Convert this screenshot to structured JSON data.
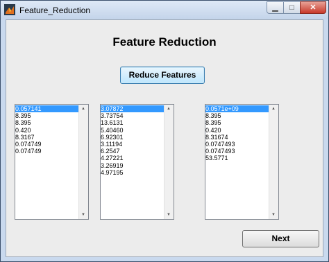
{
  "window": {
    "title": "Feature_Reduction"
  },
  "heading": "Feature Reduction",
  "buttons": {
    "reduce_label": "Reduce Features",
    "next_label": "Next"
  },
  "lists": {
    "list1": [
      "0.057141",
      "8.395",
      "8.395",
      "0.420",
      "8.3167",
      "0.074749",
      "0.074749"
    ],
    "list2": [
      "3.07872",
      "3.73754",
      "13.6131",
      "5.40460",
      "6.92301",
      "3.11194",
      "6.2547",
      "4.27221",
      "3.26919",
      "4.97195"
    ],
    "list3": [
      "0.0571e+09",
      "8.395",
      "8.395",
      "0.420",
      "8.31674",
      "0.0747493",
      "0.0747493",
      "53.5771"
    ]
  },
  "colors": {
    "selection": "#3399ff",
    "window_frame": "#c9d9ee",
    "panel": "#ececec"
  }
}
